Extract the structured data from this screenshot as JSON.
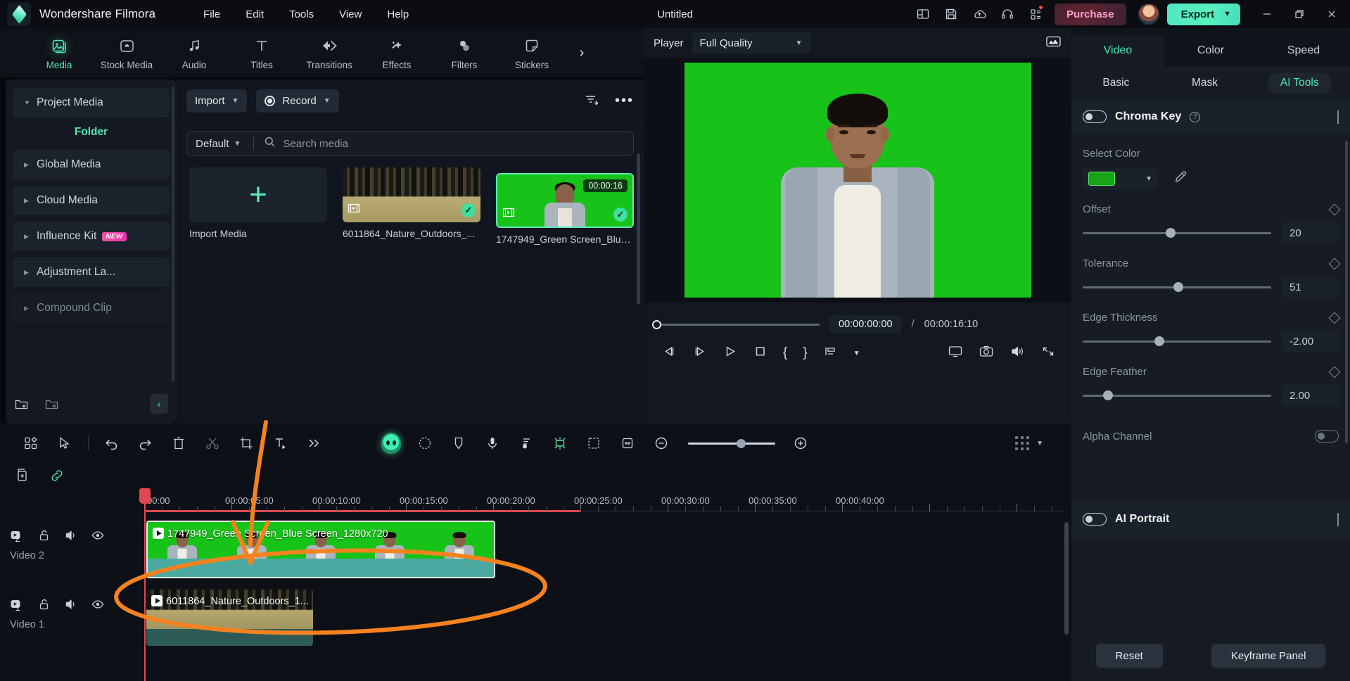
{
  "titlebar": {
    "app_name": "Wondershare Filmora",
    "document_title": "Untitled",
    "menus": [
      "File",
      "Edit",
      "Tools",
      "View",
      "Help"
    ],
    "icons": [
      "layout-icon",
      "save-icon",
      "cloud-upload-icon",
      "headset-support-icon",
      "apps-grid-icon"
    ],
    "purchase_label": "Purchase",
    "export_label": "Export",
    "window_buttons": [
      "minimize",
      "restore",
      "close"
    ]
  },
  "nav_tabs": [
    {
      "label": "Media",
      "icon": "media-icon",
      "active": true
    },
    {
      "label": "Stock Media",
      "icon": "stock-media-icon",
      "active": false
    },
    {
      "label": "Audio",
      "icon": "audio-note-icon",
      "active": false
    },
    {
      "label": "Titles",
      "icon": "titles-text-icon",
      "active": false
    },
    {
      "label": "Transitions",
      "icon": "transitions-icon",
      "active": false
    },
    {
      "label": "Effects",
      "icon": "effects-wand-icon",
      "active": false
    },
    {
      "label": "Filters",
      "icon": "filters-icon",
      "active": false
    },
    {
      "label": "Stickers",
      "icon": "stickers-icon",
      "active": false
    }
  ],
  "sidebar": {
    "project_media": "Project Media",
    "folder_heading": "Folder",
    "items": [
      {
        "label": "Global Media",
        "badge": ""
      },
      {
        "label": "Cloud Media",
        "badge": ""
      },
      {
        "label": "Influence Kit",
        "badge": "NEW"
      },
      {
        "label": "Adjustment La...",
        "badge": ""
      },
      {
        "label": "Compound Clip",
        "badge": ""
      }
    ],
    "footer_icons": [
      "new-folder-icon",
      "delete-folder-icon",
      "collapse-sidebar-icon"
    ]
  },
  "media_panel": {
    "import_label": "Import",
    "record_label": "Record",
    "filter_icon": "filter-icon",
    "more_icon": "more-options-icon",
    "sort_label": "Default",
    "search_placeholder": "Search media",
    "search_value": "",
    "items": [
      {
        "label": "Import Media",
        "type": "import",
        "duration": "",
        "selected": false
      },
      {
        "label": "6011864_Nature_Outdoors_...",
        "type": "nature",
        "duration": "",
        "selected": true
      },
      {
        "label": "1747949_Green Screen_Blue...",
        "type": "green",
        "duration": "00:00:16",
        "selected": true
      }
    ]
  },
  "player": {
    "label": "Player",
    "quality": "Full Quality",
    "histogram_icon": "histogram-icon",
    "current_time": "00:00:00:00",
    "separator": "/",
    "total_time": "00:00:16:10",
    "controls": [
      "prev-frame-icon",
      "next-frame-icon",
      "play-icon",
      "stop-icon",
      "mark-in-icon",
      "mark-out-icon",
      "split-icon",
      "chevron-down-icon",
      "screen-icon",
      "snapshot-icon",
      "volume-icon",
      "fullscreen-icon"
    ]
  },
  "right_panel": {
    "tabs": [
      "Video",
      "Color",
      "Speed"
    ],
    "active_tab": "Video",
    "subtabs": [
      "Basic",
      "Mask",
      "AI Tools"
    ],
    "active_subtab": "AI Tools",
    "chroma_key": {
      "title": "Chroma Key",
      "enabled": false,
      "select_color_label": "Select Color",
      "color_hex": "#18a318",
      "eyedropper_icon": "eyedropper-icon",
      "sliders": [
        {
          "label": "Offset",
          "value": "20",
          "pct": 46
        },
        {
          "label": "Tolerance",
          "value": "51",
          "pct": 50
        },
        {
          "label": "Edge Thickness",
          "value": "-2.00",
          "pct": 40
        },
        {
          "label": "Edge Feather",
          "value": "2.00",
          "pct": 13
        }
      ],
      "alpha_channel_label": "Alpha Channel",
      "alpha_channel_enabled": false
    },
    "ai_portrait": {
      "title": "AI Portrait",
      "enabled": false
    },
    "reset_label": "Reset",
    "keyframe_label": "Keyframe Panel"
  },
  "timeline": {
    "toolbar_icons": [
      "templates-icon",
      "select-tool-icon",
      "undo-icon",
      "redo-icon",
      "delete-icon",
      "split-scissors-icon",
      "crop-icon",
      "text-icon",
      "more-chevrons-icon",
      "ai-portrait-avatar-icon",
      "motion-tracking-icon",
      "marker-icon",
      "voiceover-mic-icon",
      "audio-mixer-icon",
      "keyframe-green-icon",
      "color-match-icon",
      "fit-timeline-icon",
      "zoom-out-icon",
      "zoom-in-icon",
      "render-grid-icon"
    ],
    "second_row_icons": [
      "add-track-icon",
      "link-icon"
    ],
    "ruler_labels": [
      "00:00",
      "00:00:05:00",
      "00:00:10:00",
      "00:00:15:00",
      "00:00:20:00",
      "00:00:25:00",
      "00:00:30:00",
      "00:00:35:00",
      "00:00:40:00"
    ],
    "tracks": [
      {
        "number": "2",
        "name": "Video 2",
        "icons": [
          "track-video-icon",
          "unlock-icon",
          "mute-icon",
          "eye-visible-icon"
        ],
        "clip_title": "1747949_Green Screen_Blue Screen_1280x720",
        "selected": true
      },
      {
        "number": "1",
        "name": "Video 1",
        "icons": [
          "track-video-icon",
          "unlock-icon",
          "mute-icon",
          "eye-visible-icon"
        ],
        "clip_title": "6011864_Nature_Outdoors_1...",
        "selected": false
      }
    ]
  },
  "annotations": {
    "arrow_color": "#f5821f",
    "ellipse_color": "#f5821f"
  }
}
